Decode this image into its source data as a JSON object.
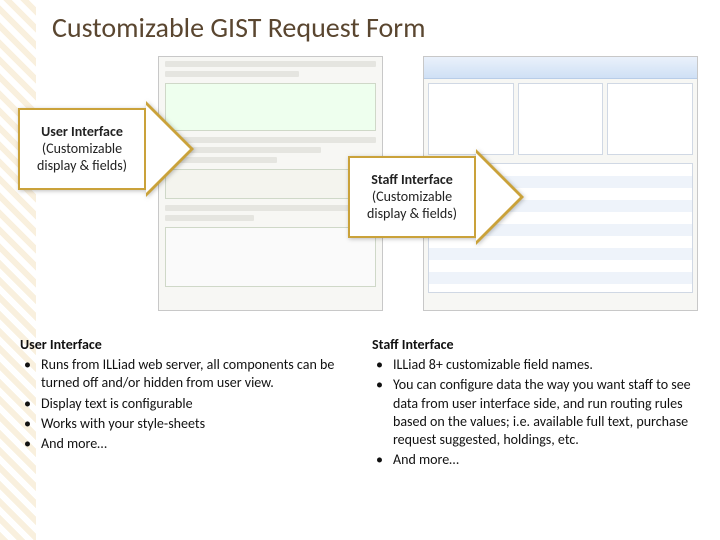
{
  "title": "Customizable GIST Request Form",
  "arrow_left": {
    "bold": "User Interface",
    "rest": "(Customizable display & fields)"
  },
  "arrow_right": {
    "bold": "Staff Interface",
    "rest": "(Customizable display & fields)"
  },
  "left_col": {
    "heading": "User Interface",
    "items": [
      "Runs from ILLiad web server, all components can be turned off and/or hidden from user view.",
      "Display text is configurable",
      "Works with your style-sheets",
      "And more…"
    ]
  },
  "right_col": {
    "heading": "Staff Interface",
    "items": [
      "ILLiad 8+ customizable field names.",
      "You can configure data the way you want staff to see data from user interface side, and run routing rules based on the values; i.e. available full text, purchase request suggested, holdings, etc.",
      "And more…"
    ]
  }
}
